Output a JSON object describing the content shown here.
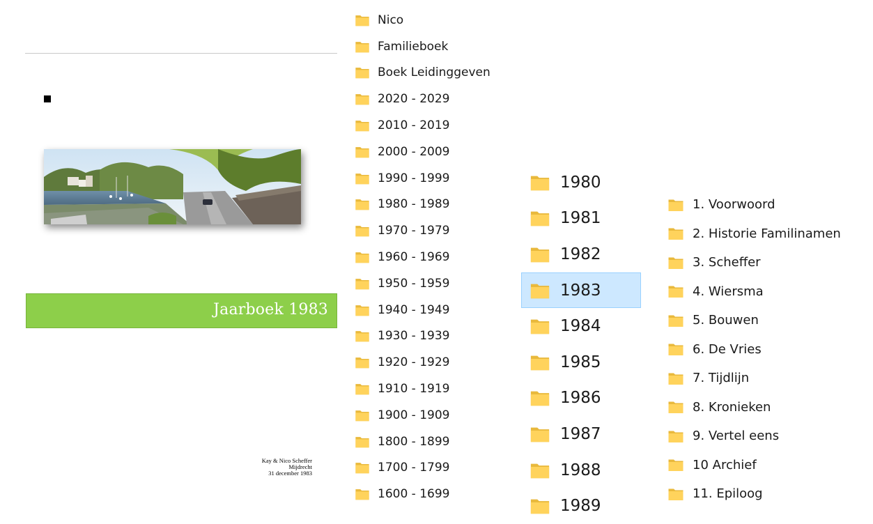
{
  "document": {
    "banner_title": "Jaarboek 1983",
    "credits": [
      "Kay & Nico Scheffer",
      "Mijdrecht",
      "31 december 1983"
    ],
    "banner_color": "#8dcf4a"
  },
  "root_folders": [
    "Nico",
    "Familieboek",
    "Boek Leidinggeven",
    "2020 - 2029",
    "2010 - 2019",
    "2000 - 2009",
    "1990 - 1999",
    "1980 - 1989",
    "1970 - 1979",
    "1960 - 1969",
    "1950 - 1959",
    "1940 - 1949",
    "1930 - 1939",
    "1920 - 1929",
    "1910 - 1919",
    "1900 - 1909",
    "1800 - 1899",
    "1700 - 1799",
    "1600 - 1699"
  ],
  "year_folders": {
    "items": [
      "1980",
      "1981",
      "1982",
      "1983",
      "1984",
      "1985",
      "1986",
      "1987",
      "1988",
      "1989"
    ],
    "selected": "1983",
    "selection_color": "#cde8ff"
  },
  "chapter_folders": [
    "1. Voorwoord",
    "2. Historie Familinamen",
    "3. Scheffer",
    "4. Wiersma",
    "5. Bouwen",
    "6. De Vries",
    "7. Tijdlijn",
    "8. Kronieken",
    "9. Vertel eens",
    "10 Archief",
    "11. Epiloog"
  ],
  "icon": {
    "name": "folder-icon",
    "color": "#ffd35c"
  }
}
